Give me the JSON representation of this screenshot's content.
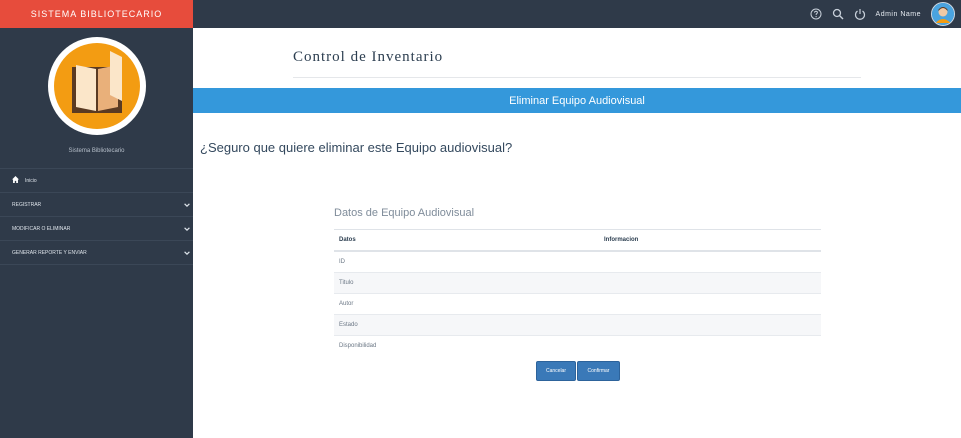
{
  "app": {
    "brand": "SISTEMA BIBLIOTECARIO",
    "user_title": "Sistema Bibliotecario"
  },
  "topbar": {
    "admin_name": "Admin Name",
    "icons": [
      "help-icon",
      "search-icon",
      "power-icon"
    ]
  },
  "sidebar": {
    "items": [
      {
        "label": "Inicio",
        "icon": "home-icon"
      },
      {
        "label": "REGISTRAR",
        "icon": "chevron-down-icon"
      },
      {
        "label": "MODIFICAR O ELIMINAR",
        "icon": "chevron-down-icon"
      },
      {
        "label": "GENERAR REPORTE Y ENVIAR",
        "icon": "chevron-down-icon"
      }
    ]
  },
  "main": {
    "page_title": "Control de Inventario",
    "banner": "Eliminar Equipo Audiovisual",
    "question": "¿Seguro que quiere eliminar este Equipo audiovisual?",
    "panel_title": "Datos de Equipo Audiovisual",
    "table": {
      "headers": [
        "Datos",
        "Informacion"
      ],
      "rows": [
        [
          "ID",
          ""
        ],
        [
          "Titulo",
          ""
        ],
        [
          "Autor",
          ""
        ],
        [
          "Estado",
          ""
        ],
        [
          "Disponibilidad",
          ""
        ]
      ]
    },
    "buttons": {
      "cancel": "Cancelar",
      "confirm": "Confirmar"
    }
  },
  "colors": {
    "sidebar": "#2f3a49",
    "brand": "#e74c3c",
    "banner": "#3498db",
    "button": "#3a79b8",
    "avatar": "#f39c12"
  }
}
